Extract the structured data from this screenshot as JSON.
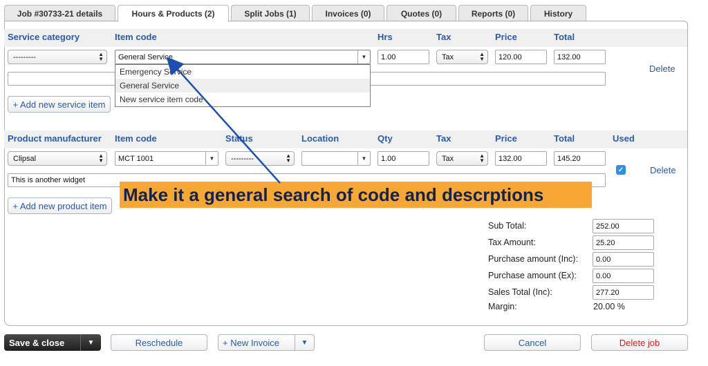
{
  "tabs": [
    {
      "label": "Job #30733-21 details"
    },
    {
      "label": "Hours & Products (2)"
    },
    {
      "label": "Split Jobs (1)"
    },
    {
      "label": "Invoices (0)"
    },
    {
      "label": "Quotes (0)"
    },
    {
      "label": "Reports (0)"
    },
    {
      "label": "History"
    }
  ],
  "service": {
    "headers": {
      "category": "Service category",
      "item_code": "Item code",
      "hrs": "Hrs",
      "tax": "Tax",
      "price": "Price",
      "total": "Total"
    },
    "category_value": "---------",
    "item_code_value": "General Service",
    "hrs": "1.00",
    "tax": "Tax",
    "price": "120.00",
    "total": "132.00",
    "description": "",
    "delete_label": "Delete",
    "add_label": "+ Add new service item",
    "dropdown_options": [
      "Emergency Service",
      "General Service",
      "New service item code"
    ],
    "dropdown_highlighted": "General Service"
  },
  "product": {
    "headers": {
      "manufacturer": "Product manufacturer",
      "item_code": "Item code",
      "status": "Status",
      "location": "Location",
      "qty": "Qty",
      "tax": "Tax",
      "price": "Price",
      "total": "Total",
      "used": "Used"
    },
    "manufacturer": "Clipsal",
    "item_code": "MCT 1001",
    "status": "---------",
    "location": "",
    "qty": "1.00",
    "tax": "Tax",
    "price": "132.00",
    "total": "145.20",
    "used": true,
    "description": "This is another widget",
    "delete_label": "Delete",
    "add_label": "+ Add new product item"
  },
  "summary": {
    "sub_total_label": "Sub Total:",
    "sub_total": "252.00",
    "tax_amount_label": "Tax Amount:",
    "tax_amount": "25.20",
    "purchase_inc_label": "Purchase amount (Inc):",
    "purchase_inc": "0.00",
    "purchase_ex_label": "Purchase amount (Ex):",
    "purchase_ex": "0.00",
    "sales_total_label": "Sales Total (Inc):",
    "sales_total": "277.20",
    "margin_label": "Margin:",
    "margin": "20.00 %"
  },
  "annotation": "Make it a general search of code and descrptions",
  "footer": {
    "save_close": "Save & close",
    "reschedule": "Reschedule",
    "new_invoice": "+ New Invoice",
    "cancel": "Cancel",
    "delete_job": "Delete job"
  },
  "colors": {
    "accent": "#2a5aa8",
    "annotation_bg": "#f7a733",
    "annotation_text": "#13234f",
    "delete": "#d62020"
  }
}
